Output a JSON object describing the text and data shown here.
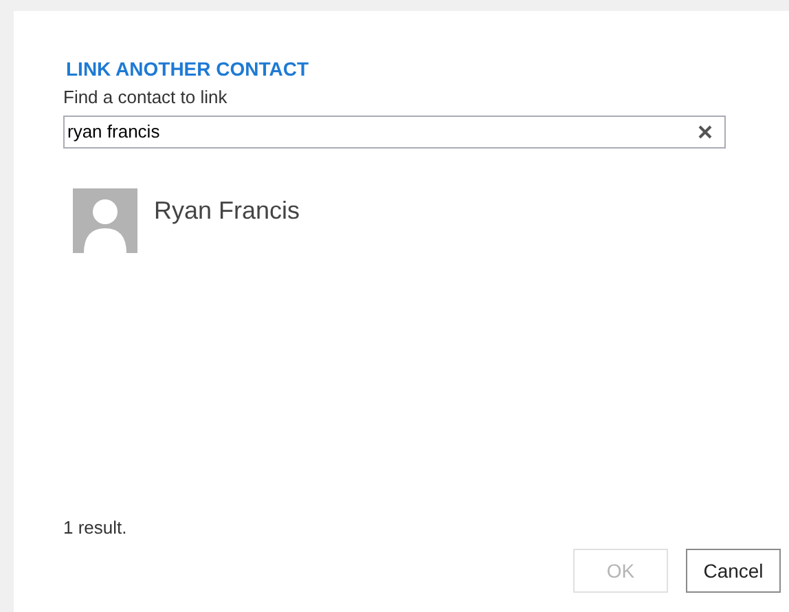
{
  "dialog": {
    "title": "LINK ANOTHER CONTACT",
    "search_label": "Find a contact to link",
    "search": {
      "value": "ryan francis"
    },
    "results": [
      {
        "name": "Ryan Francis"
      }
    ],
    "result_count": "1 result.",
    "buttons": [
      {
        "label": "OK",
        "disabled": true
      },
      {
        "label": "Cancel",
        "disabled": false
      }
    ]
  }
}
